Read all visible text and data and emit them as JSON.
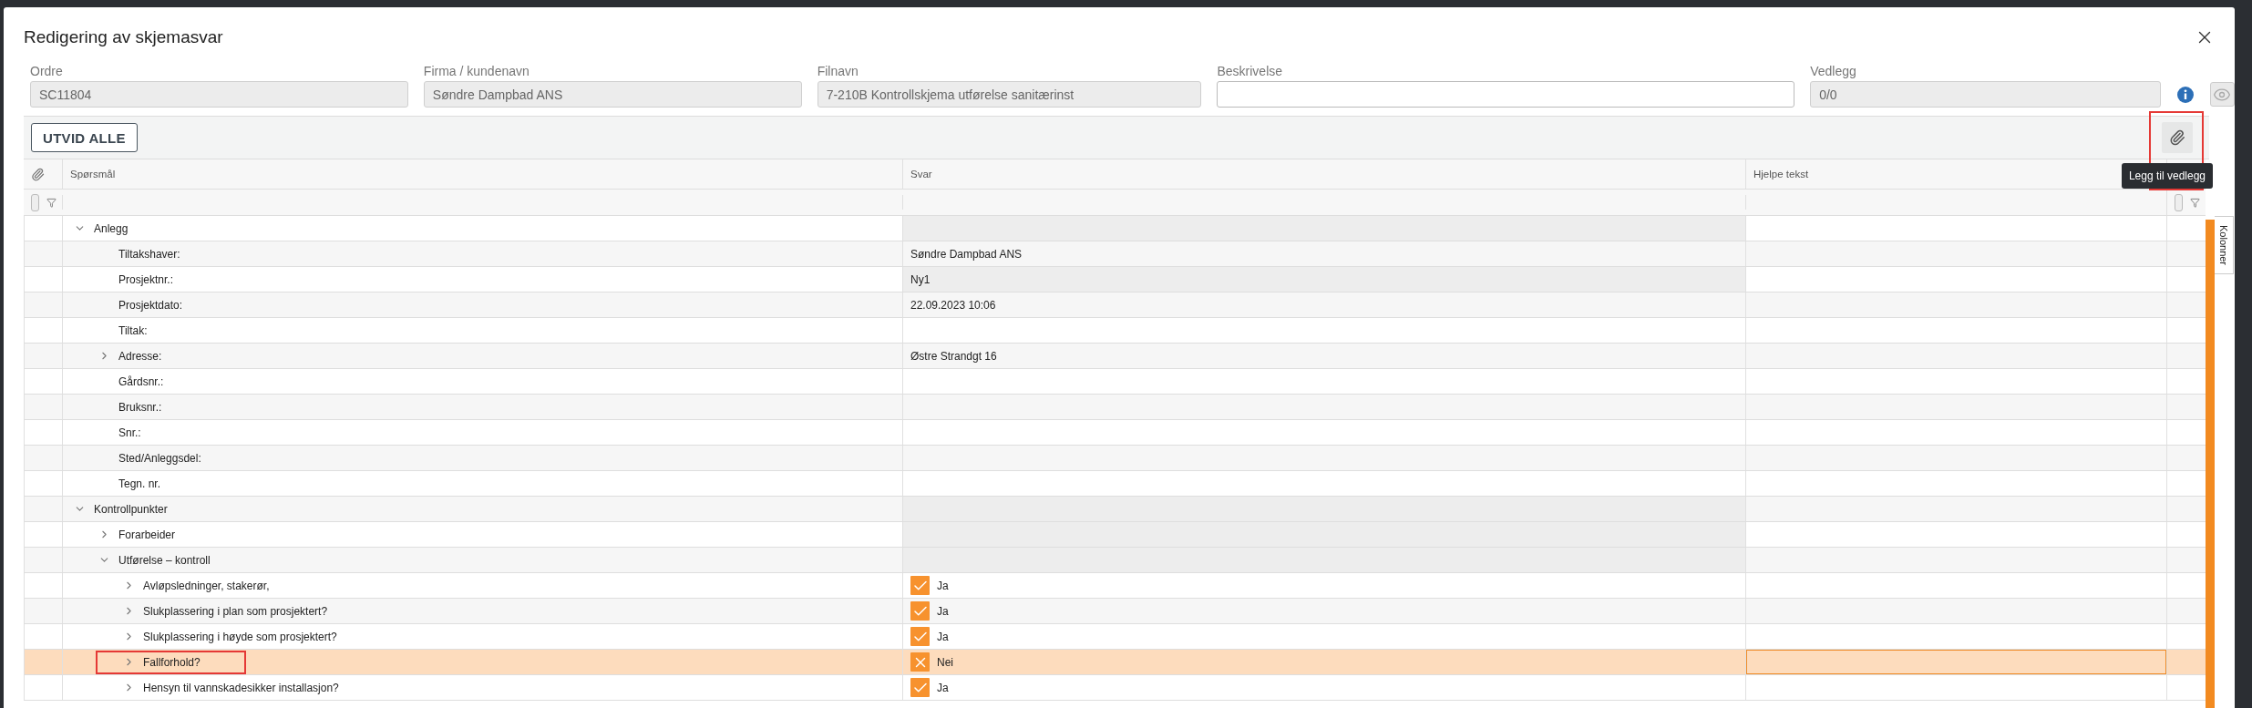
{
  "dialog": {
    "title": "Redigering av skjemasvar"
  },
  "fields": [
    {
      "label": "Ordre",
      "value": "SC11804",
      "readonly": true
    },
    {
      "label": "Firma / kundenavn",
      "value": "Søndre Dampbad ANS",
      "readonly": true
    },
    {
      "label": "Filnavn",
      "value": "7-210B Kontrollskjema utførelse sanitærinst",
      "readonly": true
    },
    {
      "label": "Beskrivelse",
      "readonly": false
    },
    {
      "label": "Vedlegg",
      "value": "0/0",
      "readonly": true
    }
  ],
  "toolbar": {
    "expand_button": "UTVID ALLE",
    "attach_tooltip": "Legg til vedlegg",
    "attach_annotated": true
  },
  "columns": [
    "Spørsmål",
    "Svar",
    "Hjelpe tekst"
  ],
  "side_tab": "Kolonner",
  "rows": [
    {
      "question": "Anlegg",
      "expanded": true,
      "answer_locked": true,
      "selected": false,
      "annotated": false,
      "children": [
        {
          "question": "Tiltakshaver:",
          "answer": {
            "kind": "text",
            "text": "Søndre Dampbad ANS"
          },
          "selected": false,
          "annotated": false
        },
        {
          "question": "Prosjektnr.:",
          "answer": {
            "kind": "text",
            "text": "Ny1"
          },
          "answer_locked": true,
          "selected": false,
          "annotated": false
        },
        {
          "question": "Prosjektdato:",
          "answer": {
            "kind": "text",
            "text": "22.09.2023 10:06"
          },
          "selected": false,
          "annotated": false
        },
        {
          "question": "Tiltak:",
          "selected": false,
          "annotated": false
        },
        {
          "question": "Adresse:",
          "expanded": false,
          "answer": {
            "kind": "text",
            "text": "Østre Strandgt 16"
          },
          "selected": false,
          "annotated": false
        },
        {
          "question": "Gårdsnr.:",
          "selected": false,
          "annotated": false
        },
        {
          "question": "Bruksnr.:",
          "selected": false,
          "annotated": false
        },
        {
          "question": "Snr.:",
          "selected": false,
          "annotated": false
        },
        {
          "question": "Sted/Anleggsdel:",
          "selected": false,
          "annotated": false
        },
        {
          "question": "Tegn. nr.",
          "selected": false,
          "annotated": false
        }
      ]
    },
    {
      "question": "Kontrollpunkter",
      "expanded": true,
      "answer_locked": true,
      "selected": false,
      "annotated": false,
      "children": [
        {
          "question": "Forarbeider",
          "expanded": false,
          "answer_locked": true,
          "selected": false,
          "annotated": false
        },
        {
          "question": "Utførelse – kontroll",
          "expanded": true,
          "answer_locked": true,
          "selected": false,
          "annotated": false,
          "children": [
            {
              "question": "Avløpsledninger, stakerør,",
              "expanded": false,
              "answer": {
                "kind": "check",
                "text": "Ja"
              },
              "selected": false,
              "annotated": false
            },
            {
              "question": "Slukplassering i plan som prosjektert?",
              "expanded": false,
              "answer": {
                "kind": "check",
                "text": "Ja"
              },
              "selected": false,
              "annotated": false
            },
            {
              "question": "Slukplassering i høyde som prosjektert?",
              "expanded": false,
              "answer": {
                "kind": "check",
                "text": "Ja"
              },
              "selected": false,
              "annotated": false
            },
            {
              "question": "Fallforhold?",
              "expanded": false,
              "answer": {
                "kind": "cross",
                "text": "Nei"
              },
              "selected": true,
              "annotated": true
            },
            {
              "question": "Hensyn til vannskadesikker installasjon?",
              "expanded": false,
              "answer": {
                "kind": "check",
                "text": "Ja"
              },
              "selected": false,
              "annotated": false
            }
          ]
        }
      ]
    }
  ]
}
